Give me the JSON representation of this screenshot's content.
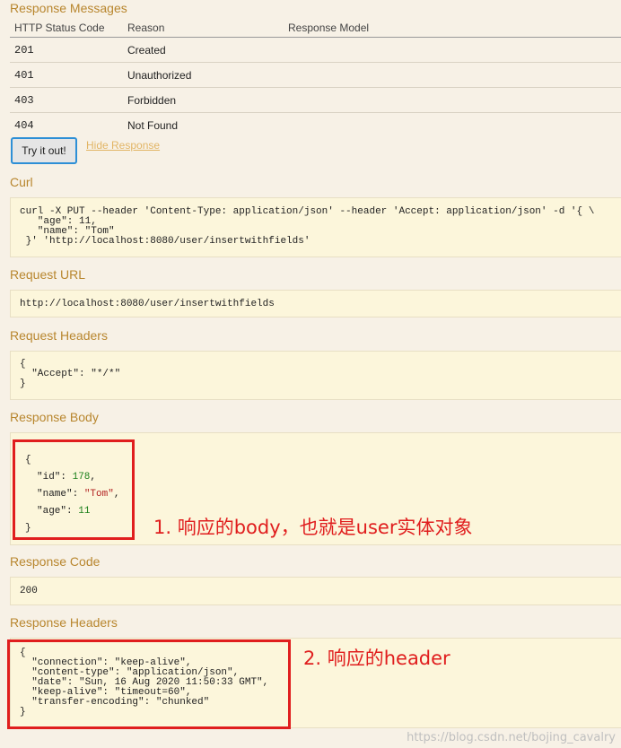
{
  "response_messages": {
    "title": "Response Messages",
    "headers": [
      "HTTP Status Code",
      "Reason",
      "Response Model"
    ],
    "rows": [
      {
        "code": "201",
        "reason": "Created",
        "model": ""
      },
      {
        "code": "401",
        "reason": "Unauthorized",
        "model": ""
      },
      {
        "code": "403",
        "reason": "Forbidden",
        "model": ""
      },
      {
        "code": "404",
        "reason": "Not Found",
        "model": ""
      }
    ]
  },
  "actions": {
    "try_label": "Try it out!",
    "hide_label": "Hide Response"
  },
  "curl": {
    "title": "Curl",
    "text": "curl -X PUT --header 'Content-Type: application/json' --header 'Accept: application/json' -d '{ \\ \n   \"age\": 11, \n   \"name\": \"Tom\" \n }' 'http://localhost:8080/user/insertwithfields'"
  },
  "request_url": {
    "title": "Request URL",
    "text": "http://localhost:8080/user/insertwithfields"
  },
  "request_headers": {
    "title": "Request Headers",
    "text": "{\n  \"Accept\": \"*/*\"\n}"
  },
  "response_body": {
    "title": "Response Body",
    "open": "{",
    "id_key": "\"id\": ",
    "id_val": "178",
    "name_key": "\"name\": ",
    "name_val": "\"Tom\"",
    "age_key": "\"age\": ",
    "age_val": "11",
    "close": "}"
  },
  "response_code": {
    "title": "Response Code",
    "text": "200"
  },
  "response_headers": {
    "title": "Response Headers",
    "text": "{\n  \"connection\": \"keep-alive\",\n  \"content-type\": \"application/json\",\n  \"date\": \"Sun, 16 Aug 2020 11:50:33 GMT\",\n  \"keep-alive\": \"timeout=60\",\n  \"transfer-encoding\": \"chunked\"\n}"
  },
  "annotations": {
    "body_note": "1. 响应的body，也就是user实体对象",
    "header_note": "2. 响应的header"
  },
  "watermark": "https://blog.csdn.net/bojing_cavalry",
  "colors": {
    "page_bg": "#f7f1e6",
    "section_title": "#b8862e",
    "code_block_bg": "#fcf6db",
    "annotation_red": "#e01e1e",
    "button_border": "#2d8fd6",
    "link": "#e2b565"
  }
}
